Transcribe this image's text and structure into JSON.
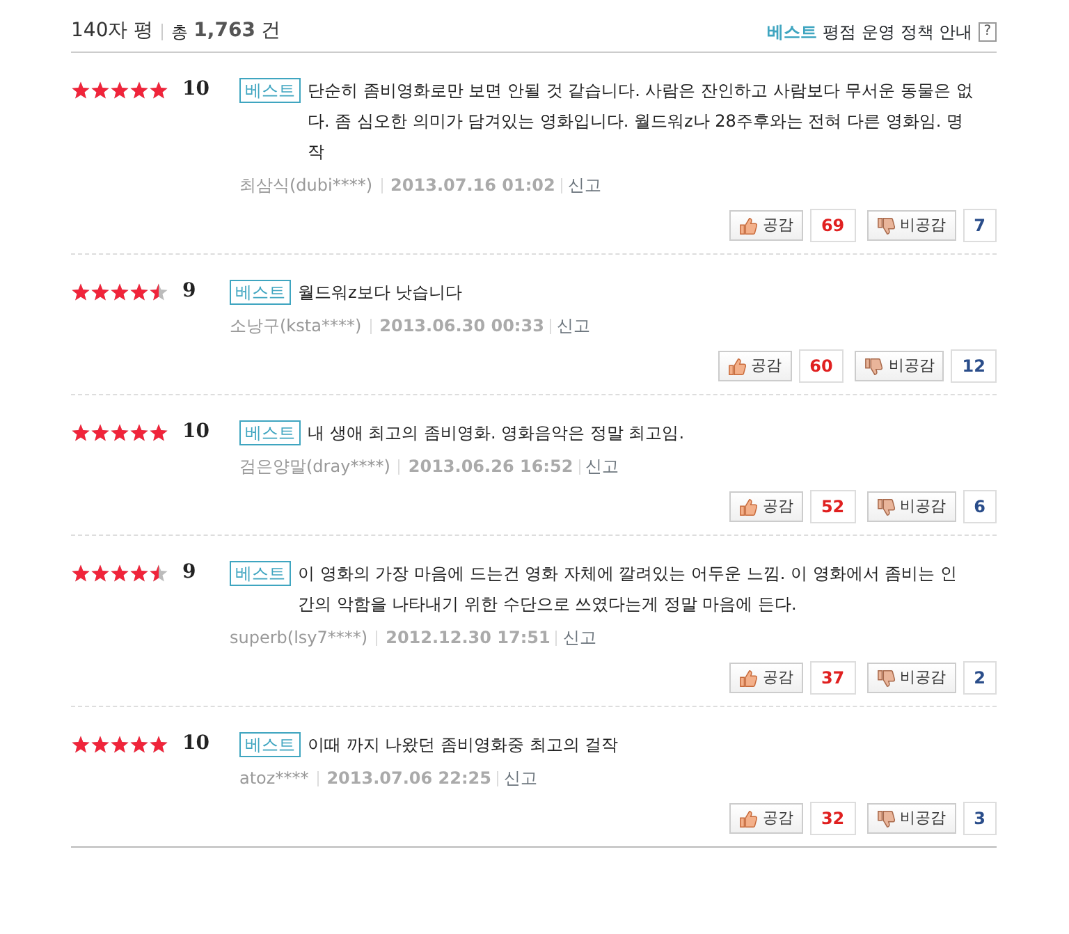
{
  "header": {
    "title": "140자 평",
    "total_label": "총",
    "total_count": "1,763",
    "total_unit": "건",
    "policy_best": "베스트",
    "policy_text": "평점 운영 정책 안내",
    "help": "?"
  },
  "reviews": [
    {
      "stars": 5,
      "score": "10",
      "badge": "베스트",
      "text": "단순히 좀비영화로만 보면 안될 것 같습니다. 사람은 잔인하고 사람보다 무서운 동물은 없다. 좀 심오한 의미가 담겨있는 영화입니다. 월드워z나 28주후와는 전혀 다른 영화임. 명작",
      "author": "최삼식(dubi****)",
      "date": "2013.07.16 01:02",
      "report": "신고",
      "like_label": "공감",
      "likes": "69",
      "dislike_label": "비공감",
      "dislikes": "7"
    },
    {
      "stars": 4.5,
      "score": "9",
      "badge": "베스트",
      "text": "월드워z보다 낫습니다",
      "author": "소낭구(ksta****)",
      "date": "2013.06.30 00:33",
      "report": "신고",
      "like_label": "공감",
      "likes": "60",
      "dislike_label": "비공감",
      "dislikes": "12"
    },
    {
      "stars": 5,
      "score": "10",
      "badge": "베스트",
      "text": "내 생애 최고의 좀비영화. 영화음악은 정말 최고임.",
      "author": "검은양말(dray****)",
      "date": "2013.06.26 16:52",
      "report": "신고",
      "like_label": "공감",
      "likes": "52",
      "dislike_label": "비공감",
      "dislikes": "6"
    },
    {
      "stars": 4.5,
      "score": "9",
      "badge": "베스트",
      "text": "이 영화의 가장 마음에 드는건 영화 자체에 깔려있는 어두운 느낌. 이 영화에서 좀비는 인간의 악함을 나타내기 위한 수단으로 쓰였다는게 정말 마음에 든다.",
      "author": "superb(lsy7****)",
      "date": "2012.12.30 17:51",
      "report": "신고",
      "like_label": "공감",
      "likes": "37",
      "dislike_label": "비공감",
      "dislikes": "2"
    },
    {
      "stars": 5,
      "score": "10",
      "badge": "베스트",
      "text": "이때 까지 나왔던 좀비영화중 최고의 걸작",
      "author": "atoz****",
      "date": "2013.07.06 22:25",
      "report": "신고",
      "like_label": "공감",
      "likes": "32",
      "dislike_label": "비공감",
      "dislikes": "3"
    }
  ]
}
